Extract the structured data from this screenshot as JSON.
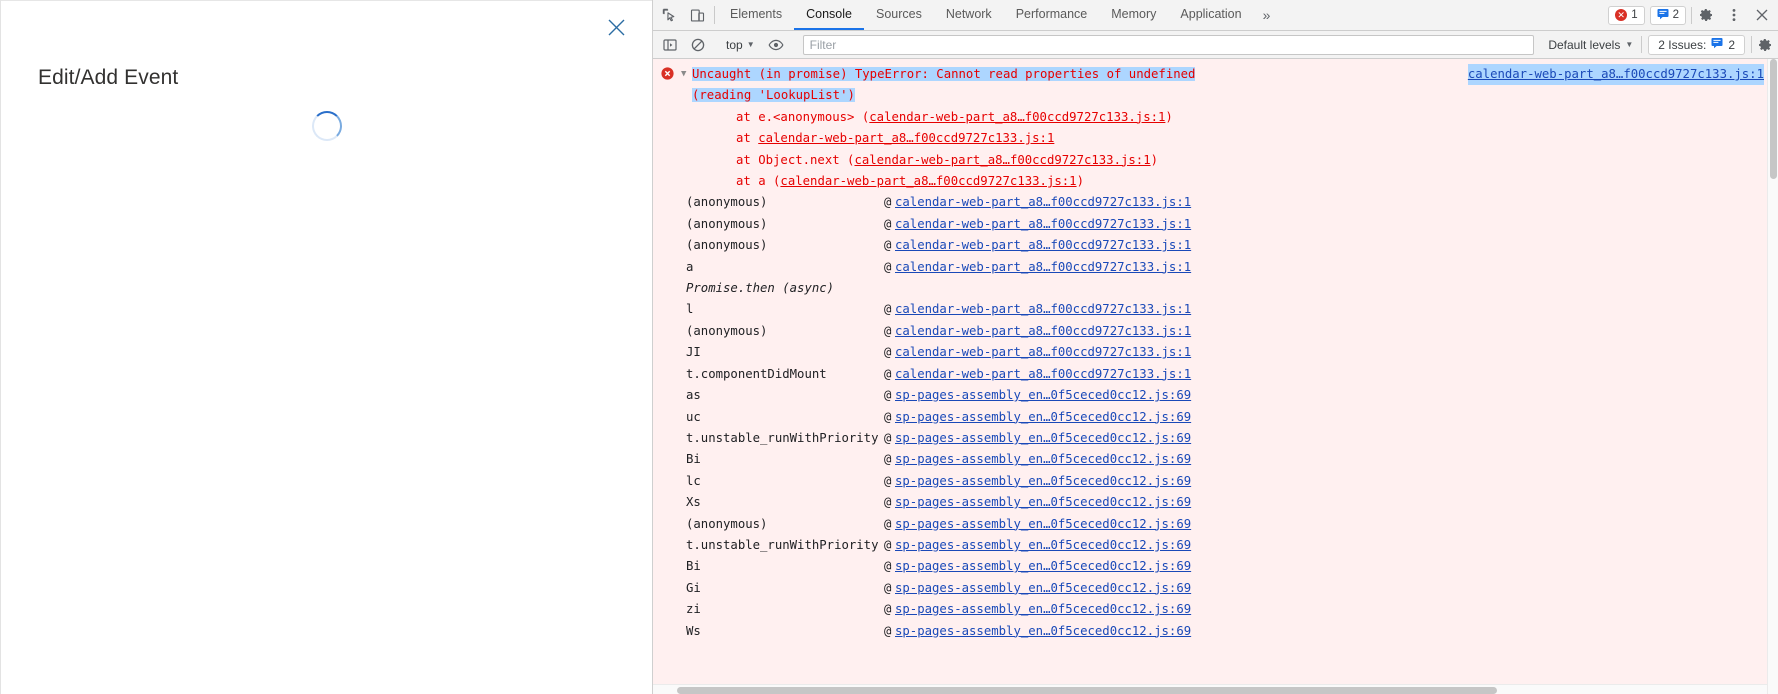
{
  "dialog": {
    "title": "Edit/Add Event",
    "close_icon": "close-icon",
    "spinner_label": "loading-spinner"
  },
  "devtools": {
    "toolbar": {
      "inspect_icon": "inspect-element-icon",
      "device_icon": "device-toolbar-icon",
      "tabs": [
        {
          "label": "Elements",
          "active": false
        },
        {
          "label": "Console",
          "active": true
        },
        {
          "label": "Sources",
          "active": false
        },
        {
          "label": "Network",
          "active": false
        },
        {
          "label": "Performance",
          "active": false
        },
        {
          "label": "Memory",
          "active": false
        },
        {
          "label": "Application",
          "active": false
        }
      ],
      "more_tabs": "»",
      "error_count": "1",
      "message_count": "2",
      "settings_icon": "gear-icon",
      "menu_icon": "kebab-menu-icon",
      "close_icon": "close-devtools-icon"
    },
    "filterbar": {
      "sidebar_icon": "console-sidebar-icon",
      "clear_icon": "clear-console-icon",
      "context": "top",
      "eye_icon": "live-expression-icon",
      "filter_placeholder": "Filter",
      "filter_value": "",
      "levels": "Default levels",
      "issues_label": "2 Issues:",
      "issues_count": "2",
      "gear_icon": "console-settings-icon"
    },
    "console": {
      "error": {
        "icon": "error-icon",
        "disclosure": "▼",
        "message_line1": "Uncaught (in promise) TypeError: Cannot read properties of undefined",
        "message_line2": "(reading 'LookupList')",
        "source_link": "calendar-web-part_a8…f00ccd9727c133.js:1",
        "at_frames": [
          {
            "prefix": "at e.<anonymous> (",
            "link": "calendar-web-part_a8…f00ccd9727c133.js:1",
            "suffix": ")"
          },
          {
            "prefix": "at ",
            "link": "calendar-web-part_a8…f00ccd9727c133.js:1",
            "suffix": ""
          },
          {
            "prefix": "at Object.next (",
            "link": "calendar-web-part_a8…f00ccd9727c133.js:1",
            "suffix": ")"
          },
          {
            "prefix": "at a (",
            "link": "calendar-web-part_a8…f00ccd9727c133.js:1",
            "suffix": ")"
          }
        ],
        "frames": [
          {
            "name": "(anonymous)",
            "at": "@",
            "url": "calendar-web-part_a8…f00ccd9727c133.js:1",
            "async": false
          },
          {
            "name": "(anonymous)",
            "at": "@",
            "url": "calendar-web-part_a8…f00ccd9727c133.js:1",
            "async": false
          },
          {
            "name": "(anonymous)",
            "at": "@",
            "url": "calendar-web-part_a8…f00ccd9727c133.js:1",
            "async": false
          },
          {
            "name": "a",
            "at": "@",
            "url": "calendar-web-part_a8…f00ccd9727c133.js:1",
            "async": false
          },
          {
            "name": "Promise.then (async)",
            "at": "",
            "url": "",
            "async": true
          },
          {
            "name": "l",
            "at": "@",
            "url": "calendar-web-part_a8…f00ccd9727c133.js:1",
            "async": false
          },
          {
            "name": "(anonymous)",
            "at": "@",
            "url": "calendar-web-part_a8…f00ccd9727c133.js:1",
            "async": false
          },
          {
            "name": "JI",
            "at": "@",
            "url": "calendar-web-part_a8…f00ccd9727c133.js:1",
            "async": false
          },
          {
            "name": "t.componentDidMount",
            "at": "@",
            "url": "calendar-web-part_a8…f00ccd9727c133.js:1",
            "async": false
          },
          {
            "name": "as",
            "at": "@",
            "url": "sp-pages-assembly_en…0f5ceced0cc12.js:69",
            "async": false
          },
          {
            "name": "uc",
            "at": "@",
            "url": "sp-pages-assembly_en…0f5ceced0cc12.js:69",
            "async": false
          },
          {
            "name": "t.unstable_runWithPriority",
            "at": "@",
            "url": "sp-pages-assembly_en…0f5ceced0cc12.js:69",
            "async": false
          },
          {
            "name": "Bi",
            "at": "@",
            "url": "sp-pages-assembly_en…0f5ceced0cc12.js:69",
            "async": false
          },
          {
            "name": "lc",
            "at": "@",
            "url": "sp-pages-assembly_en…0f5ceced0cc12.js:69",
            "async": false
          },
          {
            "name": "Xs",
            "at": "@",
            "url": "sp-pages-assembly_en…0f5ceced0cc12.js:69",
            "async": false
          },
          {
            "name": "(anonymous)",
            "at": "@",
            "url": "sp-pages-assembly_en…0f5ceced0cc12.js:69",
            "async": false
          },
          {
            "name": "t.unstable_runWithPriority",
            "at": "@",
            "url": "sp-pages-assembly_en…0f5ceced0cc12.js:69",
            "async": false
          },
          {
            "name": "Bi",
            "at": "@",
            "url": "sp-pages-assembly_en…0f5ceced0cc12.js:69",
            "async": false
          },
          {
            "name": "Gi",
            "at": "@",
            "url": "sp-pages-assembly_en…0f5ceced0cc12.js:69",
            "async": false
          },
          {
            "name": "zi",
            "at": "@",
            "url": "sp-pages-assembly_en…0f5ceced0cc12.js:69",
            "async": false
          },
          {
            "name": "Ws",
            "at": "@",
            "url": "sp-pages-assembly_en…0f5ceced0cc12.js:69",
            "async": false
          }
        ]
      }
    }
  },
  "colors": {
    "error_bg": "#fff0f0",
    "error_text": "#e60000",
    "link": "#1a49b8",
    "selection": "#add6ff",
    "accent": "#1a73e8",
    "spinner": "#2a6fca"
  }
}
